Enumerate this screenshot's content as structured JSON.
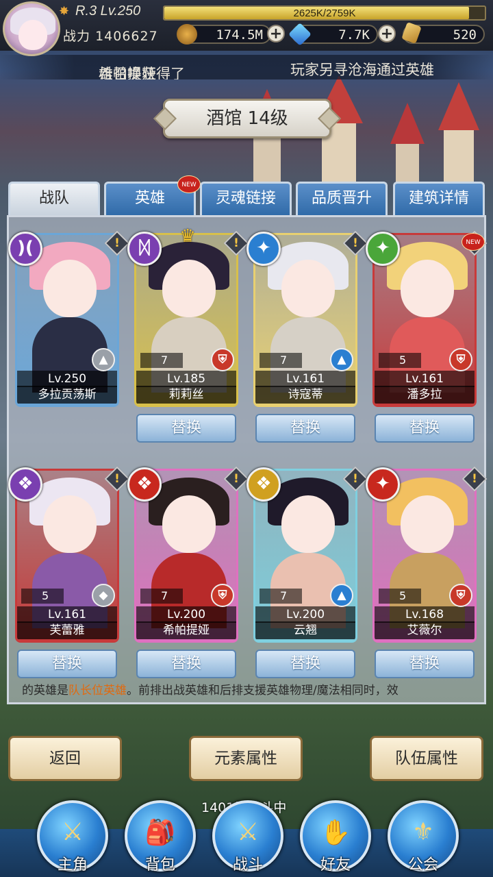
{
  "header": {
    "rank": "R.3 Lv.250",
    "exp_text": "2625K/2759K",
    "exp_fraction": 0.951,
    "power_label": "战力",
    "power_value": "1406627",
    "gold": "174.5M",
    "crystal": "7.7K",
    "ticket": "520"
  },
  "marquee": {
    "line1_pre": "雄召唤获得了",
    "line1_hero": "希帕提娅",
    "line2": "玩家另寻沧海通过英雄"
  },
  "title": "酒馆 14级",
  "tabs": [
    {
      "label": "战队",
      "active": true
    },
    {
      "label": "英雄",
      "badge": "NEW"
    },
    {
      "label": "灵魂链接"
    },
    {
      "label": "品质晋升"
    },
    {
      "label": "建筑详情"
    }
  ],
  "heroes": [
    {
      "name": "多拉贡荡斯",
      "level": "Lv.250",
      "stars": "",
      "elem_color": "#7a3fb0",
      "elem_icon": "moon-icon",
      "elem_glyph": ")(",
      "class_color": "#9aa0a8",
      "class_icon": "mage-icon",
      "card_color": "#6aa6d8",
      "hair_color": "#f2a9c0",
      "body_color": "#2a2e45",
      "captain": true,
      "swap": ""
    },
    {
      "name": "莉莉丝",
      "level": "Lv.185",
      "stars": "7",
      "elem_color": "#7a3fb0",
      "elem_icon": "dark-rune-icon",
      "elem_glyph": "ᛞ",
      "class_color": "#c8382a",
      "class_icon": "warrior-icon",
      "card_color": "#d8c04a",
      "hair_color": "#2a2238",
      "body_color": "#d8cfc0",
      "crown": "C",
      "swap": "替换"
    },
    {
      "name": "诗寇蒂",
      "level": "Lv.161",
      "stars": "7",
      "elem_color": "#2a7fd1",
      "elem_icon": "water-swirl-icon",
      "elem_glyph": "✦",
      "class_color": "#2a7fd1",
      "class_icon": "mage-icon",
      "card_color": "#e8d070",
      "hair_color": "#e8e8ef",
      "body_color": "#d6d0c6",
      "swap": "替换"
    },
    {
      "name": "潘多拉",
      "level": "Lv.161",
      "stars": "5",
      "elem_color": "#4aa63a",
      "elem_icon": "wind-swirl-icon",
      "elem_glyph": "✦",
      "class_color": "#c8382a",
      "class_icon": "warrior-icon",
      "card_color": "#c83a3a",
      "hair_color": "#f2d27a",
      "body_color": "#e05a5a",
      "badge": "NEW",
      "swap": "替换"
    },
    {
      "name": "芙蕾雅",
      "level": "Lv.161",
      "stars": "5",
      "elem_color": "#7a3fb0",
      "elem_icon": "wing-icon",
      "elem_glyph": "❖",
      "class_color": "#9aa0a8",
      "class_icon": "knight-icon",
      "card_color": "#c83a3a",
      "hair_color": "#ece6f2",
      "body_color": "#8a5aa8",
      "swap": "替换"
    },
    {
      "name": "希帕提娅",
      "level": "Lv.200",
      "stars": "7",
      "elem_color": "#c8281e",
      "elem_icon": "wing-icon",
      "elem_glyph": "❖",
      "class_color": "#c8382a",
      "class_icon": "warrior-icon",
      "card_color": "#e070c0",
      "hair_color": "#2a1f1f",
      "body_color": "#b82a2a",
      "swap": "替换"
    },
    {
      "name": "云翘",
      "level": "Lv.200",
      "stars": "7",
      "elem_color": "#d0a020",
      "elem_icon": "wing-icon",
      "elem_glyph": "❖",
      "class_color": "#2a7fd1",
      "class_icon": "mage-icon",
      "card_color": "#7fd0e0",
      "hair_color": "#1f1a2a",
      "body_color": "#eac0b0",
      "swap": "替换"
    },
    {
      "name": "艾薇尔",
      "level": "Lv.168",
      "stars": "5",
      "elem_color": "#c8281e",
      "elem_icon": "fire-swirl-icon",
      "elem_glyph": "✦",
      "class_color": "#c8382a",
      "class_icon": "warrior-icon",
      "card_color": "#e070c0",
      "hair_color": "#f2c060",
      "body_color": "#c8a060",
      "swap": "替换"
    }
  ],
  "tip": {
    "pre": "的英雄是",
    "highlight": "队长位英雄",
    "post": "。前排出战英雄和后排支援英雄物理/魔法相同时，效"
  },
  "buttons": {
    "back": "返回",
    "element": "元素属性",
    "team": "队伍属性"
  },
  "floor_text": "1401层战斗中",
  "nav": [
    {
      "label": "主角",
      "icon": "helmet-icon",
      "glyph": "⚔"
    },
    {
      "label": "背包",
      "icon": "backpack-icon",
      "glyph": "🎒"
    },
    {
      "label": "战斗",
      "icon": "crossed-swords-icon",
      "glyph": "⚔"
    },
    {
      "label": "好友",
      "icon": "handshake-icon",
      "glyph": "✋"
    },
    {
      "label": "公会",
      "icon": "guild-crest-icon",
      "glyph": "⚜"
    }
  ]
}
